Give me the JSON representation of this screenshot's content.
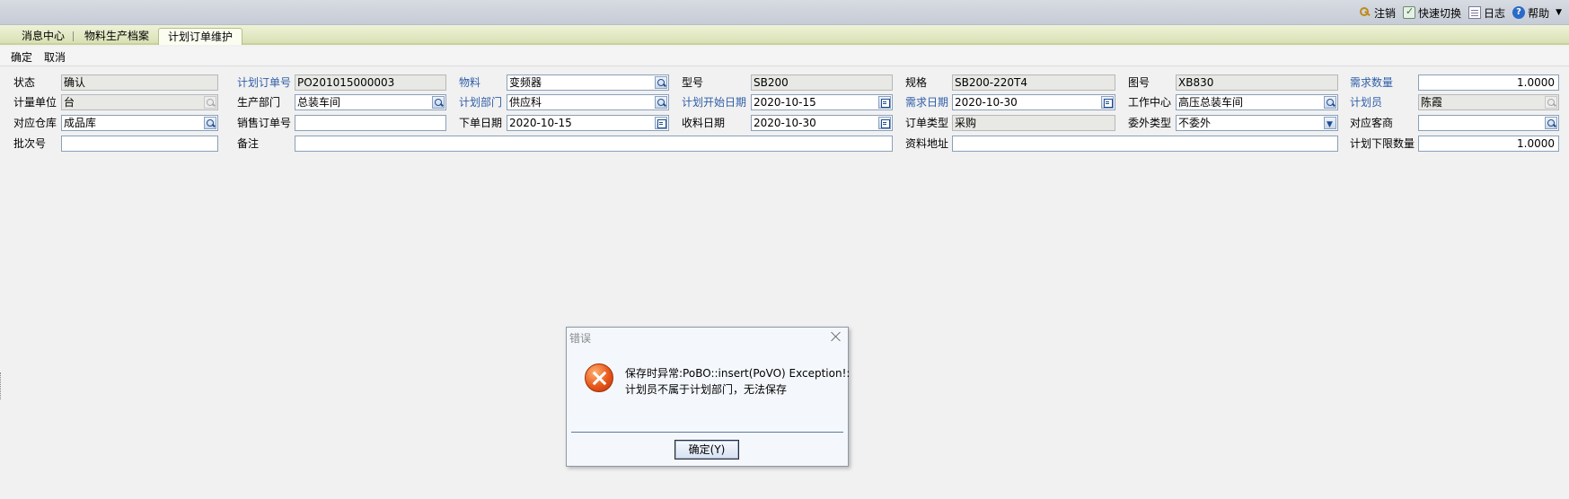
{
  "topbar": {
    "links": [
      {
        "label": "注销",
        "icon": "key-icon"
      },
      {
        "label": "快速切换",
        "icon": "switch-icon"
      },
      {
        "label": "日志",
        "icon": "log-icon"
      },
      {
        "label": "帮助",
        "icon": "help-icon"
      }
    ]
  },
  "tabs": [
    {
      "label": "消息中心",
      "active": false
    },
    {
      "label": "物料生产档案",
      "active": false
    },
    {
      "label": "计划订单维护",
      "active": true
    }
  ],
  "actions": {
    "confirm": "确定",
    "cancel": "取消"
  },
  "form": {
    "status": {
      "label": "状态",
      "value": "确认"
    },
    "plan_order_no": {
      "label": "计划订单号",
      "value": "PO201015000003"
    },
    "material": {
      "label": "物料",
      "value": "变频器"
    },
    "model": {
      "label": "型号",
      "value": "SB200"
    },
    "spec": {
      "label": "规格",
      "value": "SB200-220T4"
    },
    "drawing_no": {
      "label": "图号",
      "value": "XB830"
    },
    "demand_qty": {
      "label": "需求数量",
      "value": "1.0000"
    },
    "unit": {
      "label": "计量单位",
      "value": "台"
    },
    "prod_dept": {
      "label": "生产部门",
      "value": "总装车间"
    },
    "plan_dept": {
      "label": "计划部门",
      "value": "供应科"
    },
    "plan_start_date": {
      "label": "计划开始日期",
      "value": "2020-10-15"
    },
    "demand_date": {
      "label": "需求日期",
      "value": "2020-10-30"
    },
    "work_center": {
      "label": "工作中心",
      "value": "高压总装车间"
    },
    "planner": {
      "label": "计划员",
      "value": "陈霞"
    },
    "warehouse": {
      "label": "对应仓库",
      "value": "成品库"
    },
    "sales_order_no": {
      "label": "销售订单号",
      "value": ""
    },
    "order_date": {
      "label": "下单日期",
      "value": "2020-10-15"
    },
    "receive_date": {
      "label": "收料日期",
      "value": "2020-10-30"
    },
    "order_type": {
      "label": "订单类型",
      "value": "采购"
    },
    "outsource_type": {
      "label": "委外类型",
      "value": "不委外"
    },
    "customer": {
      "label": "对应客商",
      "value": ""
    },
    "batch_no": {
      "label": "批次号",
      "value": ""
    },
    "remark": {
      "label": "备注",
      "value": ""
    },
    "doc_url": {
      "label": "资料地址",
      "value": ""
    },
    "plan_min_qty": {
      "label": "计划下限数量",
      "value": "1.0000"
    }
  },
  "dialog": {
    "title": "错误",
    "message_line1": "保存时异常:PoBO::insert(PoVO) Exception!:",
    "message_line2": "计划员不属于计划部门，无法保存",
    "ok_label": "确定(Y)",
    "icon": "error-icon"
  },
  "colors": {
    "label_blue": "#2f5ea8",
    "tab_strip": "#d9e0b4",
    "readonly_field": "#e8e8e4"
  }
}
